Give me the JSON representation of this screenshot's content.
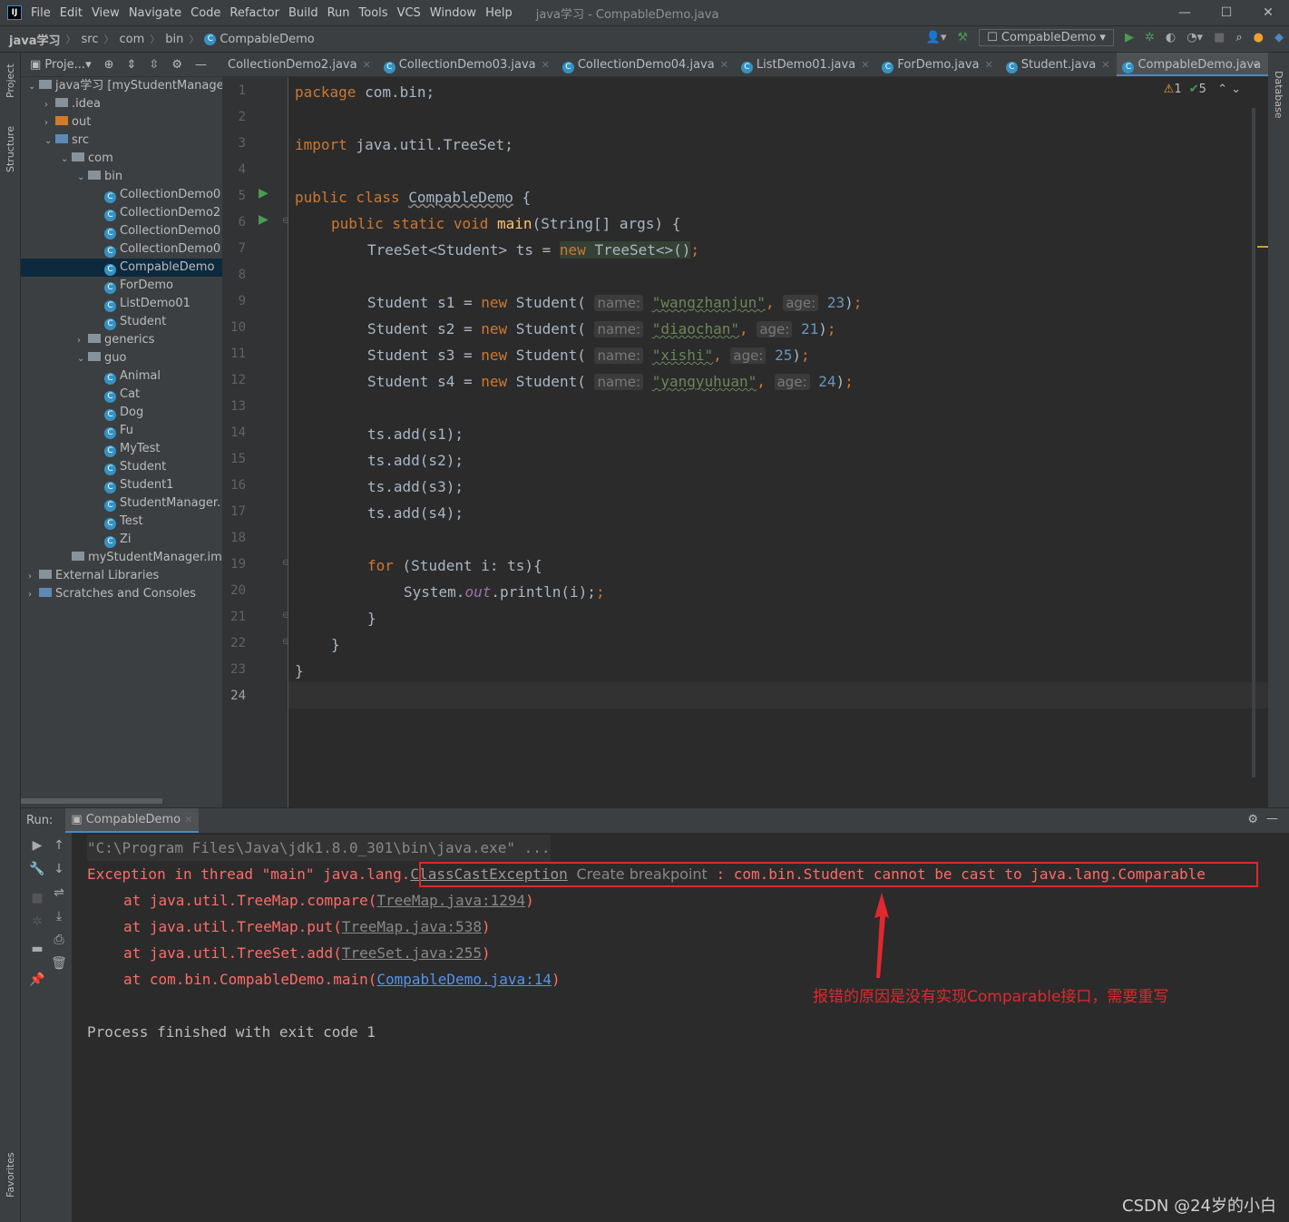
{
  "menubar": {
    "items": [
      "File",
      "Edit",
      "View",
      "Navigate",
      "Code",
      "Refactor",
      "Build",
      "Run",
      "Tools",
      "VCS",
      "Window",
      "Help"
    ],
    "window_title": "java学习 - CompableDemo.java"
  },
  "breadcrumb": {
    "project": "java学习",
    "items": [
      "src",
      "com",
      "bin",
      "CompableDemo"
    ],
    "run_config": "CompableDemo"
  },
  "side_labels": {
    "project": "Project",
    "structure": "Structure",
    "favorites": "Favorites",
    "database": "Database"
  },
  "project_panel": {
    "title": "Proje...",
    "tree": [
      {
        "label": "java学习 [myStudentManage",
        "level": 0,
        "type": "module",
        "expanded": true
      },
      {
        "label": ".idea",
        "level": 1,
        "type": "folder",
        "expanded": false
      },
      {
        "label": "out",
        "level": 1,
        "type": "folder-orange",
        "expanded": false
      },
      {
        "label": "src",
        "level": 1,
        "type": "folder-blue",
        "expanded": true
      },
      {
        "label": "com",
        "level": 2,
        "type": "package",
        "expanded": true
      },
      {
        "label": "bin",
        "level": 3,
        "type": "package",
        "expanded": true
      },
      {
        "label": "CollectionDemo0",
        "level": 4,
        "type": "class"
      },
      {
        "label": "CollectionDemo2",
        "level": 4,
        "type": "class"
      },
      {
        "label": "CollectionDemo0",
        "level": 4,
        "type": "class"
      },
      {
        "label": "CollectionDemo0",
        "level": 4,
        "type": "class"
      },
      {
        "label": "CompableDemo",
        "level": 4,
        "type": "class",
        "selected": true
      },
      {
        "label": "ForDemo",
        "level": 4,
        "type": "class"
      },
      {
        "label": "ListDemo01",
        "level": 4,
        "type": "class"
      },
      {
        "label": "Student",
        "level": 4,
        "type": "class"
      },
      {
        "label": "generics",
        "level": 3,
        "type": "package",
        "expanded": false
      },
      {
        "label": "guo",
        "level": 3,
        "type": "package",
        "expanded": true
      },
      {
        "label": "Animal",
        "level": 4,
        "type": "class"
      },
      {
        "label": "Cat",
        "level": 4,
        "type": "class"
      },
      {
        "label": "Dog",
        "level": 4,
        "type": "class"
      },
      {
        "label": "Fu",
        "level": 4,
        "type": "class"
      },
      {
        "label": "MyTest",
        "level": 4,
        "type": "class"
      },
      {
        "label": "Student",
        "level": 4,
        "type": "class"
      },
      {
        "label": "Student1",
        "level": 4,
        "type": "class"
      },
      {
        "label": "StudentManager.",
        "level": 4,
        "type": "class"
      },
      {
        "label": "Test",
        "level": 4,
        "type": "class"
      },
      {
        "label": "Zi",
        "level": 4,
        "type": "class"
      },
      {
        "label": "myStudentManager.iml",
        "level": 2,
        "type": "file"
      },
      {
        "label": "External Libraries",
        "level": 0,
        "type": "library",
        "expanded": false
      },
      {
        "label": "Scratches and Consoles",
        "level": 0,
        "type": "scratch",
        "expanded": false
      }
    ]
  },
  "editor_tabs": [
    {
      "label": "CollectionDemo2.java",
      "active": false
    },
    {
      "label": "CollectionDemo03.java",
      "active": false
    },
    {
      "label": "CollectionDemo04.java",
      "active": false
    },
    {
      "label": "ListDemo01.java",
      "active": false
    },
    {
      "label": "ForDemo.java",
      "active": false
    },
    {
      "label": "Student.java",
      "active": false
    },
    {
      "label": "CompableDemo.java",
      "active": true
    }
  ],
  "inspections": {
    "warnings": "1",
    "ok": "5"
  },
  "code": {
    "line_numbers": [
      "1",
      "2",
      "3",
      "4",
      "5",
      "6",
      "7",
      "8",
      "9",
      "10",
      "11",
      "12",
      "13",
      "14",
      "15",
      "16",
      "17",
      "18",
      "19",
      "20",
      "21",
      "22",
      "23",
      "24"
    ],
    "l1_kw": "package",
    "l1_rest": " com.bin;",
    "l3_kw": "import",
    "l3_rest": " java.util.TreeSet;",
    "l5_kw": "public class ",
    "l5_name": "CompableDemo",
    "l5_rest": " {",
    "l6_kw": "public static void ",
    "l6_fn": "main",
    "l6_rest": "(String[] args) {",
    "l7_a": "TreeSet<Student> ts = ",
    "l7_kw": "new",
    "l7_b": " TreeSet<>()",
    "l7_c": ";",
    "students": [
      {
        "var": "s1",
        "name": "\"wangzhanjun\"",
        "age": "23"
      },
      {
        "var": "s2",
        "name": "\"diaochan\"",
        "age": "21"
      },
      {
        "var": "s3",
        "name": "\"xishi\"",
        "age": "25"
      },
      {
        "var": "s4",
        "name": "\"yangyuhuan\"",
        "age": "24"
      }
    ],
    "hint_name": "name:",
    "hint_age": "age:",
    "adds": [
      "ts.add(s1);",
      "ts.add(s2);",
      "ts.add(s3);",
      "ts.add(s4);"
    ],
    "l19_kw": "for",
    "l19_rest": " (Student i: ts){",
    "l20_a": "System.",
    "l20_out": "out",
    "l20_b": ".println(i);",
    "l21": "}",
    "l22": "}",
    "l23": "}"
  },
  "run_panel": {
    "label": "Run:",
    "tab": "CompableDemo",
    "cmd": "\"C:\\Program Files\\Java\\jdk1.8.0_301\\bin\\java.exe\" ...",
    "exc_prefix": "Exception in thread \"main\" java.lang.",
    "exc_class": "ClassCastException",
    "exc_bp": "Create breakpoint",
    "exc_msg": " : com.bin.Student cannot be cast to java.lang.Comparable",
    "stack": [
      {
        "at": "at java.util.TreeMap.compare(",
        "link": "TreeMap.java:1294",
        "end": ")"
      },
      {
        "at": "at java.util.TreeMap.put(",
        "link": "TreeMap.java:538",
        "end": ")"
      },
      {
        "at": "at java.util.TreeSet.add(",
        "link": "TreeSet.java:255",
        "end": ")"
      },
      {
        "at": "at com.bin.CompableDemo.main(",
        "link": "CompableDemo.java:14",
        "end": ")"
      }
    ],
    "finished": "Process finished with exit code 1"
  },
  "annotation": "报错的原因是没有实现Comparable接口，需要重写",
  "watermark": "CSDN @24岁的小白",
  "colors": {
    "error": "#ff6b68",
    "annotation": "#e0282e",
    "keyword": "#cc7832",
    "string": "#6a8759",
    "number": "#6897bb",
    "accent": "#4a88c7"
  }
}
